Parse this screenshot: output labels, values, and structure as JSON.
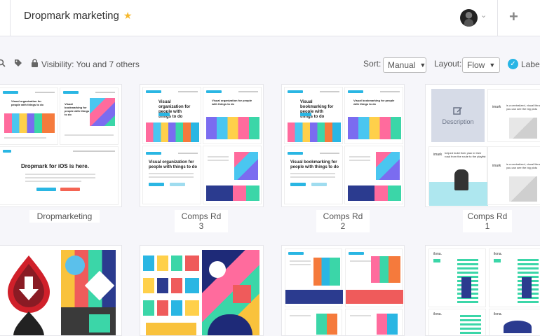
{
  "header": {
    "title": "Dropmark marketing",
    "star_icon": "star-icon",
    "star_color": "#f6b82c",
    "plus_label": "+"
  },
  "toolbar": {
    "visibility_text": "Visibility: You and 7 others",
    "sort_label": "Sort:",
    "sort_value": "Manual",
    "layout_label": "Layout:",
    "layout_value": "Flow",
    "labels_text": "Label",
    "labels_checked": true,
    "accent": "#28b5e5"
  },
  "cards": [
    {
      "label": "Dropmarketing",
      "mobile_headline": "Dropmark for iOS is here.",
      "headline_a": "Visual organization for people with things to do",
      "headline_b": "Visual bookmarking for people with things to do"
    },
    {
      "label": "Comps Rd 3",
      "headline_a": "Visual organization for people with things to do",
      "headline_b": "Visual organization for people with things to do"
    },
    {
      "label": "Comps Rd 2",
      "headline_a": "Visual bookmarking for people with things to do",
      "headline_b": "Visual bookmarking for people with things to do"
    },
    {
      "label": "Comps Rd 1",
      "description": "Description",
      "desc_text": "is a centralized, visual library of you can see the big pictu",
      "desc_text2": "helped build their plan in their road from the route to the playlist",
      "desc_text3": "is a centralized, visual library of you can see the big pictu",
      "desc_label": "imark"
    }
  ],
  "row2": [
    {
      "name": "icon-art-card"
    },
    {
      "name": "icon-grid-card"
    },
    {
      "name": "illustration-comps-card"
    },
    {
      "name": "ilona-comps-card",
      "tag": "ilona."
    }
  ]
}
